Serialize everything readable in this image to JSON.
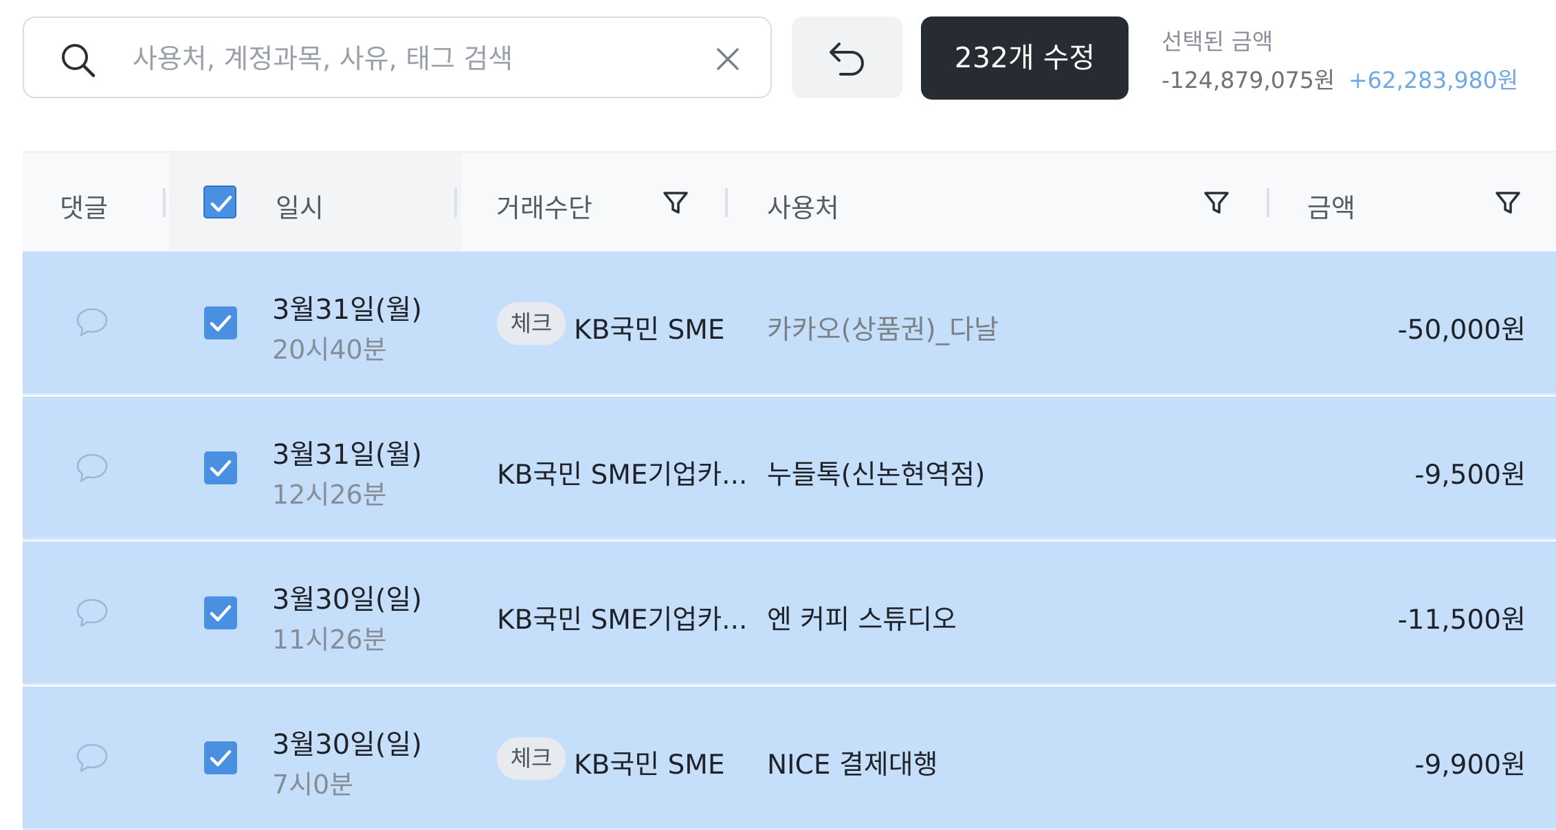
{
  "search": {
    "placeholder": "사용처, 계정과목, 사유, 태그 검색",
    "value": ""
  },
  "toolbar": {
    "edit_label": "232개 수정"
  },
  "selection": {
    "label": "선택된 금액",
    "negative_total": "-124,879,075원",
    "positive_total": "+62,283,980원"
  },
  "table": {
    "columns": {
      "comment": "댓글",
      "datetime": "일시",
      "method": "거래수단",
      "merchant": "사용처",
      "amount": "금액"
    },
    "header_checked": true,
    "rows": [
      {
        "date": "3월31일(월)",
        "time": "20시40분",
        "badge": "체크",
        "method": "KB국민 SME",
        "merchant": "카카오(상품권)_다날",
        "amount": "-50,000원",
        "checked": true
      },
      {
        "date": "3월31일(월)",
        "time": "12시26분",
        "badge": "",
        "method": "KB국민 SME기업카...",
        "merchant": "누들톡(신논현역점)",
        "amount": "-9,500원",
        "checked": true
      },
      {
        "date": "3월30일(일)",
        "time": "11시26분",
        "badge": "",
        "method": "KB국민 SME기업카...",
        "merchant": "엔 커피 스튜디오",
        "amount": "-11,500원",
        "checked": true
      },
      {
        "date": "3월30일(일)",
        "time": "7시0분",
        "badge": "체크",
        "method": "KB국민 SME",
        "merchant": "NICE 결제대행",
        "amount": "-9,900원",
        "checked": true
      }
    ]
  },
  "colors": {
    "selected_row": "#c5defa",
    "accent": "#4a90e2",
    "positive_amount": "#6fa8e6",
    "primary_button": "#272c33"
  },
  "icons": [
    "search-icon",
    "clear-icon",
    "undo-icon",
    "filter-icon",
    "comment-icon",
    "check-icon"
  ]
}
